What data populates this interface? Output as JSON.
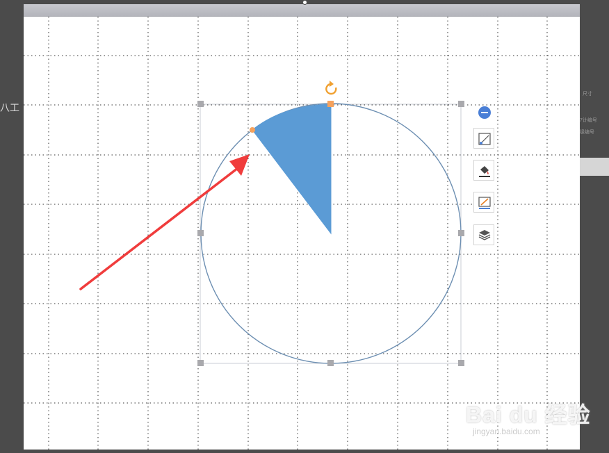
{
  "window": {
    "left_edge_text": "八工",
    "right_panel_lines": [
      "尺寸",
      "7计编号",
      "级编号"
    ]
  },
  "shape": {
    "type": "pie sector inside circle outline",
    "fill_color": "#5b9bd5",
    "outline_color": "#6d8fb2",
    "selected": true
  },
  "toolbar": {
    "collapse_icon": "minus-circle-icon",
    "buttons": [
      {
        "name": "layout-options",
        "icon": "shape-layout-icon"
      },
      {
        "name": "fill",
        "icon": "paint-bucket-icon"
      },
      {
        "name": "outline",
        "icon": "pen-outline-icon"
      },
      {
        "name": "arrange",
        "icon": "layers-icon"
      }
    ]
  },
  "annotation": {
    "arrow_color": "#f03c3c"
  },
  "watermark": {
    "logo": "Bai du 经验",
    "url": "jingyan.baidu.com"
  },
  "colors": {
    "background": "#4b4b4b",
    "slide": "#ffffff",
    "grid_dots": "#333333",
    "handle": "#a9a9ad",
    "adjust_handle": "#f5a25d",
    "rotate_handle": "#f0a030"
  }
}
